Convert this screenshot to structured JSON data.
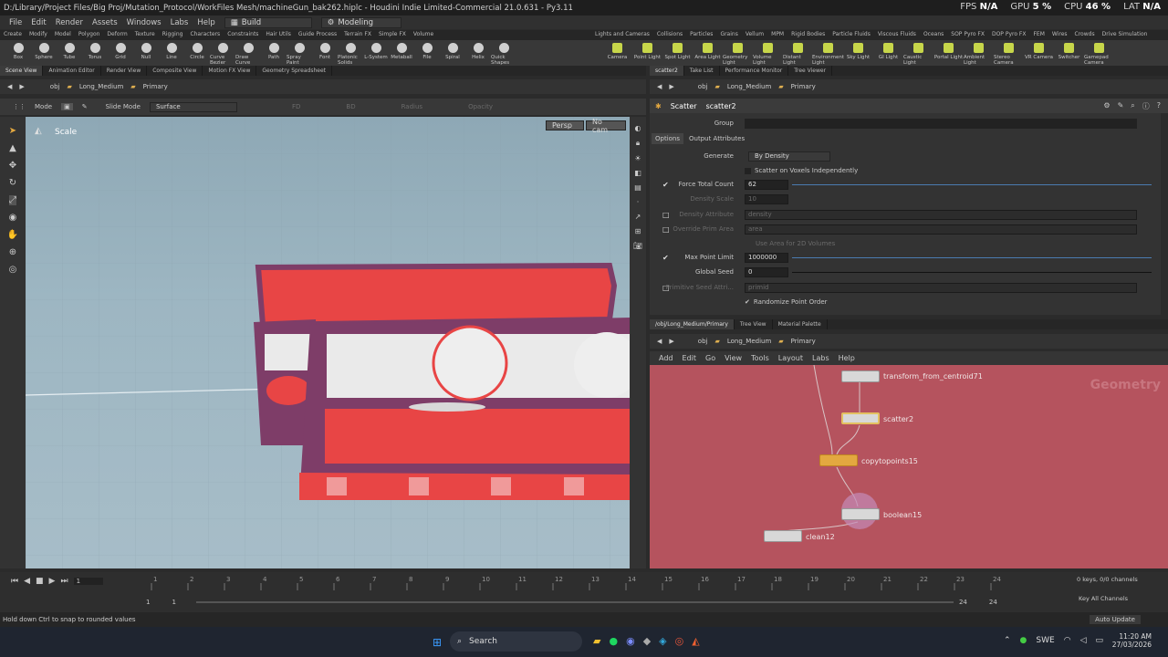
{
  "title_bar": {
    "path": "D:/Library/Project Files/Big Proj/Mutation_Protocol/WorkFiles Mesh/machineGun_bak262.hiplc - Houdini Indie Limited-Commercial 21.0.631 - Py3.11",
    "fps_label": "FPS",
    "fps_value": "N/A",
    "gpu_label": "GPU",
    "gpu_value": "5 %",
    "cpu_label": "CPU",
    "cpu_value": "46 %",
    "lat_label": "LAT",
    "lat_value": "N/A"
  },
  "menubar": {
    "items": [
      "File",
      "Edit",
      "Render",
      "Assets",
      "Windows",
      "Labs",
      "Help"
    ],
    "desktop_value": "Build",
    "context_value": "Modeling"
  },
  "shelf_tabs_left": [
    "Create",
    "Modify",
    "Model",
    "Polygon",
    "Deform",
    "Texture",
    "Rigging",
    "Characters",
    "Constraints",
    "Hair Utils",
    "Guide Process",
    "Terrain FX",
    "Simple FX",
    "Volume"
  ],
  "shelf_tabs_right": [
    "Lights and Cameras",
    "Collisions",
    "Particles",
    "Grains",
    "Vellum",
    "MPM",
    "Rigid Bodies",
    "Particle Fluids",
    "Viscous Fluids",
    "Oceans",
    "SOP Pyro FX",
    "DOP Pyro FX",
    "FEM",
    "Wires",
    "Crowds",
    "Drive Simulation"
  ],
  "shelf_tools_left": [
    "Box",
    "Sphere",
    "Tube",
    "Torus",
    "Grid",
    "Null",
    "Line",
    "Circle",
    "Curve Bezier",
    "Draw Curve",
    "Path",
    "Spray Paint",
    "Font",
    "Platonic Solids",
    "L-System",
    "Metaball",
    "File",
    "Spiral",
    "Helix",
    "Quick Shapes"
  ],
  "shelf_tools_right": [
    "Camera",
    "Point Light",
    "Spot Light",
    "Area Light",
    "Geometry Light",
    "Volume Light",
    "Distant Light",
    "Environment Light",
    "Sky Light",
    "GI Light",
    "Caustic Light",
    "Portal Light",
    "Ambient Light",
    "Stereo Camera",
    "VR Camera",
    "Switcher",
    "Gamepad Camera"
  ],
  "left_pane_tabs": [
    "Scene View",
    "Animation Editor",
    "Render View",
    "Composite View",
    "Motion FX View",
    "Geometry Spreadsheet"
  ],
  "right_pane_tabs": [
    "scatter2",
    "Take List",
    "Performance Monitor",
    "Tree Viewer"
  ],
  "path": {
    "root": "obj",
    "geo": "Long_Medium",
    "node": "Primary"
  },
  "viewport": {
    "mode_label": "Mode",
    "slide_label": "Slide Mode",
    "surface_value": "Surface",
    "fd_label": "FD",
    "bd_label": "BD",
    "radius_label": "Radius",
    "opacity_label": "Opacity",
    "tool_name": "Scale",
    "persp": "Persp",
    "cam": "No cam"
  },
  "params": {
    "node_type": "Scatter",
    "node_name": "scatter2",
    "group_label": "Group",
    "tabs": [
      "Options",
      "Output Attributes"
    ],
    "generate_label": "Generate",
    "generate_value": "By Density",
    "scatter_voxels": "Scatter on Voxels Independently",
    "force_total_label": "Force Total Count",
    "force_total_value": "62",
    "density_scale_label": "Density Scale",
    "density_scale_value": "10",
    "density_attr_label": "Density Attribute",
    "density_attr_value": "density",
    "override_area_label": "Override Prim Area",
    "override_area_value": "area",
    "use_area_label": "Use Area for 2D Volumes",
    "max_point_label": "Max Point Limit",
    "max_point_value": "1000000",
    "global_seed_label": "Global Seed",
    "global_seed_value": "0",
    "prim_seed_label": "Primitive Seed Attri...",
    "prim_seed_value": "primid",
    "randomize_label": "Randomize Point Order"
  },
  "network_tabs": [
    "/obj/Long_Medium/Primary",
    "Tree View",
    "Material Palette"
  ],
  "network_menu": [
    "Add",
    "Edit",
    "Go",
    "View",
    "Tools",
    "Layout",
    "Labs",
    "Help"
  ],
  "network": {
    "context": "Geometry",
    "nodes": [
      "transform_from_centroid71",
      "scatter2",
      "copytopoints15",
      "boolean15",
      "clean12"
    ]
  },
  "timeline": {
    "frame": "1",
    "start": "1",
    "start2": "1",
    "end": "24",
    "end2": "24",
    "ticks": [
      "1",
      "2",
      "3",
      "4",
      "5",
      "6",
      "7",
      "8",
      "9",
      "10",
      "11",
      "12",
      "13",
      "14",
      "15",
      "16",
      "17",
      "18",
      "19",
      "20",
      "21",
      "22",
      "23",
      "24"
    ],
    "keys_label": "0 keys, 0/0 channels",
    "channels_label": "Key All Channels",
    "auto_update": "Auto Update"
  },
  "status": {
    "message": "Hold down Ctrl to snap to rounded values"
  },
  "taskbar": {
    "search": "Search",
    "lang": "SWE",
    "time": "11:20 AM",
    "date": "27/03/2026"
  },
  "colors": {
    "network_bg": "#b5535e",
    "accent": "#e3a840",
    "viewport_sky": "#9db6c2"
  }
}
